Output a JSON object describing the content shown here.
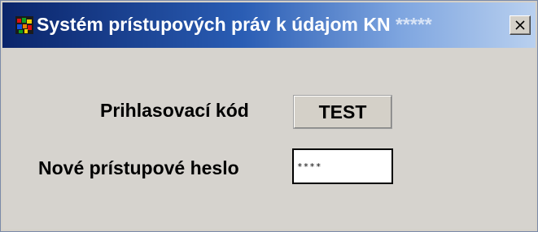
{
  "window": {
    "title": "Systém prístupových práv k údajom KN",
    "title_suffix": "*****"
  },
  "form": {
    "login_code_label": "Prihlasovací kód",
    "login_code_value": "TEST",
    "new_password_label": "Nové prístupové heslo",
    "new_password_value": "****"
  },
  "icons": {
    "app": "app-icon",
    "close": "close-icon"
  },
  "colors": {
    "titlebar_start": "#0a246a",
    "titlebar_end": "#b9d0ef",
    "window_background": "#d6d3ce"
  }
}
